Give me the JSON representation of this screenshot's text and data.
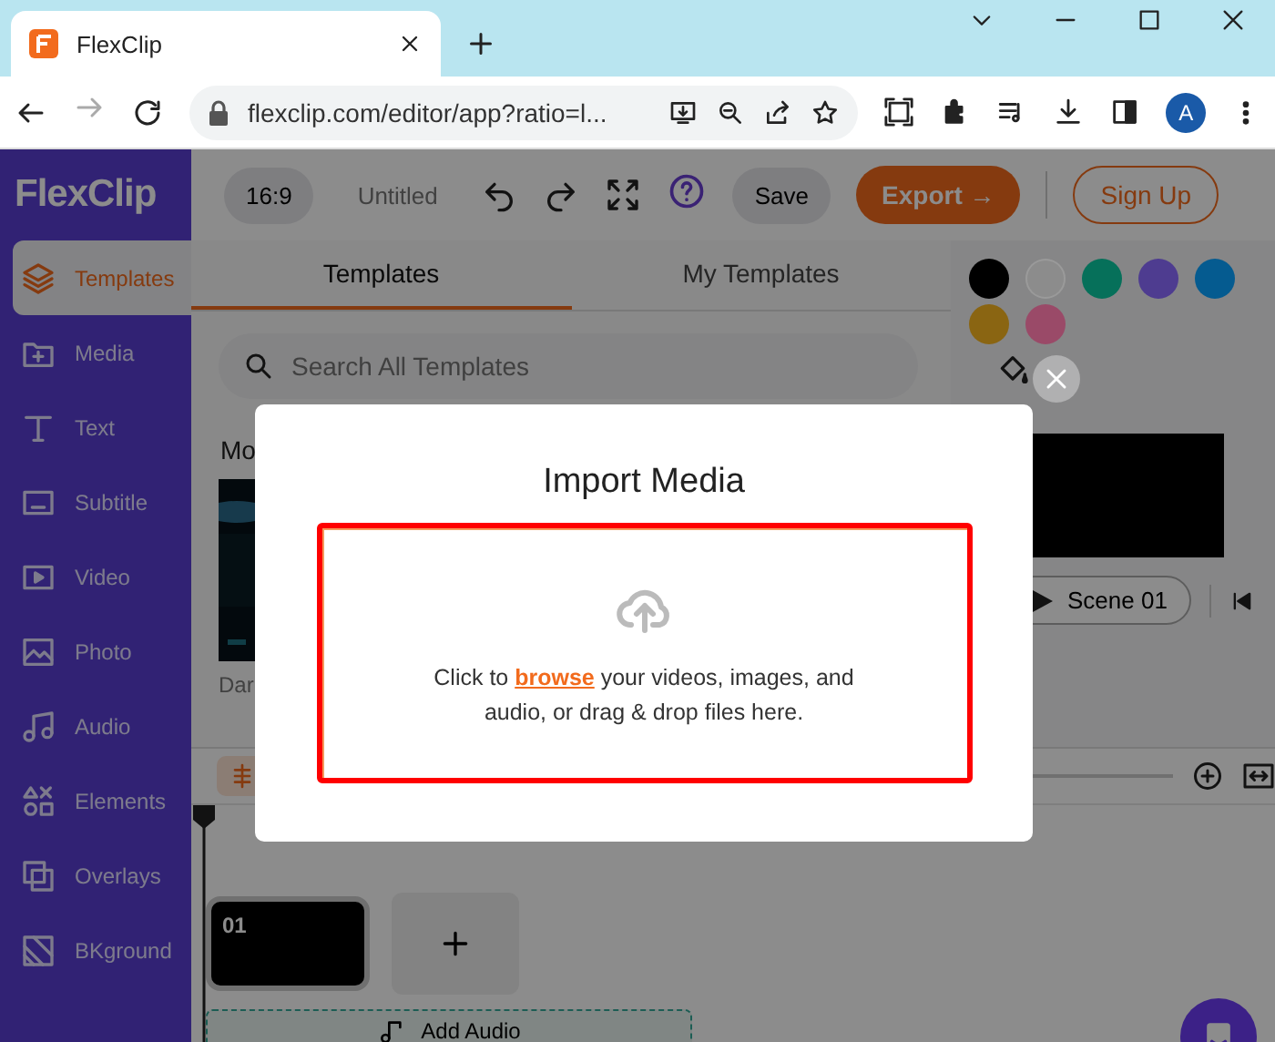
{
  "browser": {
    "tab_title": "FlexClip",
    "url": "flexclip.com/editor/app?ratio=l...",
    "avatar": "A"
  },
  "header": {
    "logo": "FlexClip",
    "ratio": "16:9",
    "project_name": "Untitled",
    "save": "Save",
    "export": "Export →",
    "sign_up": "Sign Up"
  },
  "sidebar": {
    "items": [
      {
        "label": "Templates",
        "selected": true
      },
      {
        "label": "Media",
        "selected": false
      },
      {
        "label": "Text",
        "selected": false
      },
      {
        "label": "Subtitle",
        "selected": false
      },
      {
        "label": "Video",
        "selected": false
      },
      {
        "label": "Photo",
        "selected": false
      },
      {
        "label": "Audio",
        "selected": false
      },
      {
        "label": "Elements",
        "selected": false
      },
      {
        "label": "Overlays",
        "selected": false
      },
      {
        "label": "BKground",
        "selected": false
      }
    ]
  },
  "template_panel": {
    "tabs": [
      {
        "label": "Templates",
        "selected": true
      },
      {
        "label": "My Templates",
        "selected": false
      }
    ],
    "search": {
      "placeholder": "Search All Templates"
    },
    "section_heading": "Mo",
    "template_caption": "Dar"
  },
  "right_panel": {
    "swatches": [
      {
        "color": "#000000"
      },
      {
        "color": "#8c8c8c"
      },
      {
        "color": "#06705a"
      },
      {
        "color": "#4e3c90"
      },
      {
        "color": "#055b90"
      },
      {
        "color": "#8a6512"
      },
      {
        "color": "#9a4a68"
      }
    ],
    "scene_button": "Scene 01"
  },
  "timeline": {
    "clips": [
      {
        "label": "01"
      }
    ],
    "add_audio": "Add Audio"
  },
  "modal": {
    "title": "Import Media",
    "text_before": "Click to ",
    "link": "browse",
    "text_after": " your videos, images, and audio, or drag & drop files here."
  }
}
